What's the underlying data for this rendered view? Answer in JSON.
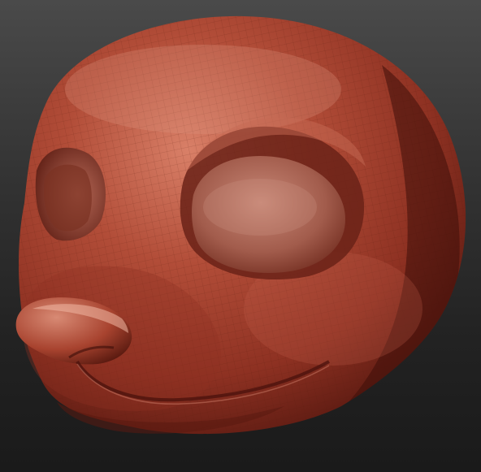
{
  "scene": {
    "background_top": "#4a4a4a",
    "background_bottom": "#1a1a1a",
    "material_color": "#9c3a2a",
    "material_highlight": "#d77a62",
    "material_shadow": "#4a120c",
    "wireframe_color": "#6b1f15",
    "subject_icon": "sculpted-creature-head"
  }
}
